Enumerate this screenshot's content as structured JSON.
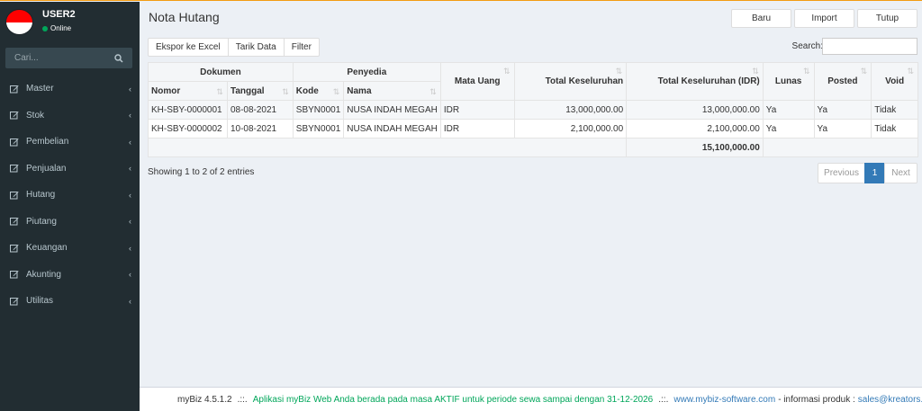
{
  "user": {
    "name": "USER2",
    "status": "Online"
  },
  "sidebar": {
    "search_placeholder": "Cari...",
    "items": [
      {
        "label": "Master"
      },
      {
        "label": "Stok"
      },
      {
        "label": "Pembelian"
      },
      {
        "label": "Penjualan"
      },
      {
        "label": "Hutang"
      },
      {
        "label": "Piutang"
      },
      {
        "label": "Keuangan"
      },
      {
        "label": "Akunting"
      },
      {
        "label": "Utilitas"
      }
    ]
  },
  "page": {
    "title": "Nota Hutang"
  },
  "top_buttons": {
    "new": "Baru",
    "import": "Import",
    "close": "Tutup"
  },
  "tools": {
    "export": "Ekspor ke Excel",
    "pull": "Tarik Data",
    "filter": "Filter"
  },
  "table_search": {
    "label": "Search:",
    "value": ""
  },
  "table": {
    "group_headers": {
      "document": "Dokumen",
      "supplier": "Penyedia"
    },
    "columns": {
      "number": "Nomor",
      "date": "Tanggal",
      "code": "Kode",
      "name": "Nama",
      "currency": "Mata Uang",
      "total": "Total Keseluruhan",
      "total_idr": "Total Keseluruhan (IDR)",
      "paid": "Lunas",
      "posted": "Posted",
      "void": "Void"
    },
    "rows": [
      {
        "number": "KH-SBY-0000001",
        "date": "08-08-2021",
        "code": "SBYN0001",
        "name": "NUSA INDAH MEGAH",
        "currency": "IDR",
        "total": "13,000,000.00",
        "total_idr": "13,000,000.00",
        "paid": "Ya",
        "posted": "Ya",
        "void": "Tidak"
      },
      {
        "number": "KH-SBY-0000002",
        "date": "10-08-2021",
        "code": "SBYN0001",
        "name": "NUSA INDAH MEGAH",
        "currency": "IDR",
        "total": "2,100,000.00",
        "total_idr": "2,100,000.00",
        "paid": "Ya",
        "posted": "Ya",
        "void": "Tidak"
      }
    ],
    "footer_total_idr": "15,100,000.00"
  },
  "info": "Showing 1 to 2 of 2 entries",
  "pagination": {
    "previous": "Previous",
    "current": "1",
    "next": "Next"
  },
  "footer": {
    "version": "myBiz 4.5.1.2",
    "sep": ".::.",
    "notice": "Aplikasi myBiz Web Anda berada pada masa AKTIF untuk periode sewa sampai dengan 31-12-2026",
    "site": "www.mybiz-software.com",
    "info_label": "- informasi produk :",
    "email": "sales@kreators.c"
  }
}
